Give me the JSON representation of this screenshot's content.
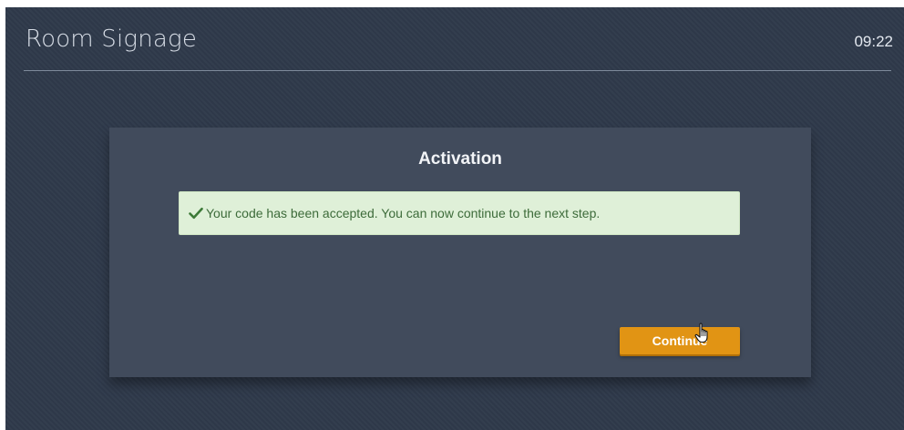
{
  "header": {
    "title": "Room Signage",
    "clock": "09:22"
  },
  "panel": {
    "title": "Activation",
    "alert": {
      "icon": "check-icon",
      "message": "Your code has been accepted. You can now continue to the next step."
    },
    "continue_label": "Continue"
  },
  "colors": {
    "background": "#2f3a4b",
    "panel": "#414b5c",
    "alert_background": "#dff0d8",
    "alert_text": "#3d6b3a",
    "button_accent": "#e19414"
  },
  "cursor": {
    "icon": "hand-pointer-icon"
  }
}
